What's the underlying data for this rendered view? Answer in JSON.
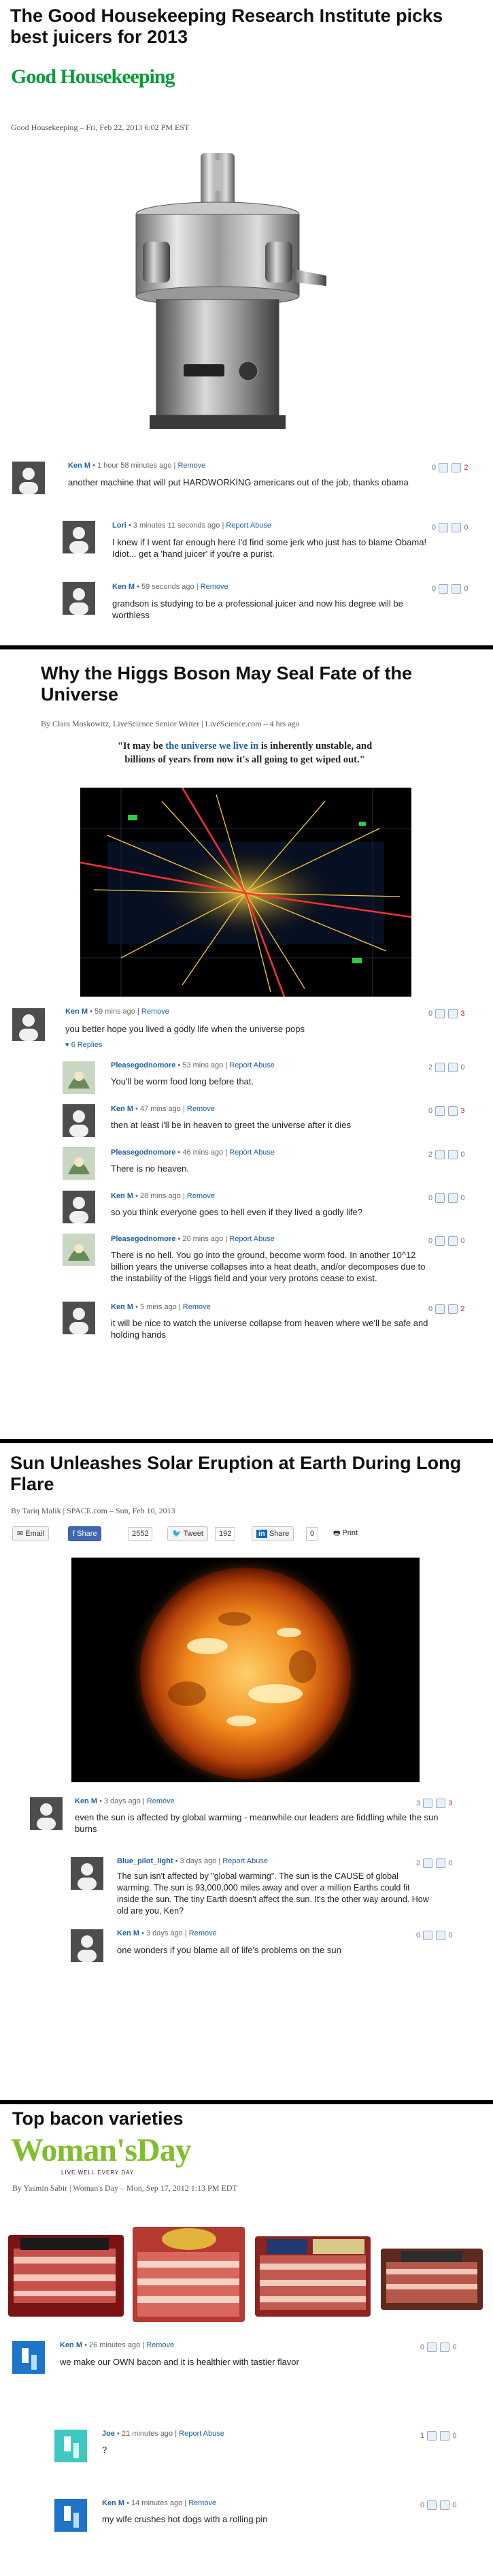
{
  "articles": [
    {
      "title_line1": "The Good Housekeeping Research Institute picks",
      "title_line2": "best juicers for 2013",
      "publication_logo": "Good Housekeeping",
      "byline": "Good Housekeeping – Fri, Feb 22, 2013 6:02 PM EST",
      "image_subject": "stainless-steel-juicer",
      "comments": [
        {
          "name": "Ken M",
          "time": "1 hour 58 minutes ago",
          "actions": "Remove",
          "up": "0",
          "down": "2",
          "text": "another machine that will put HARDWORKING americans out of the job, thanks obama"
        },
        {
          "name": "Lori",
          "time": "3 minutes 11 seconds ago",
          "actions": "Report Abuse",
          "up": "0",
          "down": "0",
          "text_line1": "I knew if I went far enough here I'd find some jerk who just has to blame Obama!",
          "text_line2": "Idiot... get a 'hand juicer' if you're a purist."
        },
        {
          "name": "Ken M",
          "time": "59 seconds ago",
          "actions": "Remove",
          "up": "0",
          "down": "0",
          "text_line1": "grandson is studying to be a professional juicer and now his degree will be",
          "text_line2": "worthless"
        }
      ]
    },
    {
      "title_line1": "Why the Higgs Boson May Seal Fate of the",
      "title_line2": "Universe",
      "byline": "By Clara Moskowitz, LiveScience Senior Writer | LiveScience.com – 4 hrs ago",
      "quote_pre": "\"It may be ",
      "quote_link": "the universe we live in",
      "quote_post": " is inherently unstable, and",
      "quote_line2": "billions of years from now it's all going to get wiped out.\"",
      "replies": "6 Replies",
      "comments": [
        {
          "name": "Ken M",
          "time": "59 mins ago",
          "actions": "Remove",
          "up": "0",
          "down": "3",
          "text": "you better hope you lived a godly life when the universe pops"
        },
        {
          "name": "Pleasegodnomore",
          "time": "53 mins ago",
          "actions": "Report Abuse",
          "up": "2",
          "down": "0",
          "text": "You'll be worm food long before that."
        },
        {
          "name": "Ken M",
          "time": "47 mins ago",
          "actions": "Remove",
          "up": "0",
          "down": "3",
          "text": "then at least i'll be in heaven to greet the universe after it dies"
        },
        {
          "name": "Pleasegodnomore",
          "time": "46 mins ago",
          "actions": "Report Abuse",
          "up": "2",
          "down": "0",
          "text": "There is no heaven."
        },
        {
          "name": "Ken M",
          "time": "28 mins ago",
          "actions": "Remove",
          "up": "0",
          "down": "0",
          "text": "so you think everyone goes to hell even if they lived a godly life?"
        },
        {
          "name": "Pleasegodnomore",
          "time": "20 mins ago",
          "actions": "Report Abuse",
          "up": "0",
          "down": "0",
          "text_line1": "There is no hell. You go into the ground, become worm food. In another 10^12",
          "text_line2": "billion years the universe collapses into a heat death, and/or decomposes due to",
          "text_line3": "the instability of the Higgs field and your very protons cease to exist."
        },
        {
          "name": "Ken M",
          "time": "5 mins ago",
          "actions": "Remove",
          "up": "0",
          "down": "2",
          "text_line1": "it will be nice to watch the universe collapse from heaven where we'll be safe and",
          "text_line2": "holding hands"
        }
      ]
    },
    {
      "title_line1": "Sun Unleashes Solar Eruption at Earth During Long",
      "title_line2": "Flare",
      "byline": "By Tariq Malik | SPACE.com – Sun, Feb 10, 2013",
      "share": {
        "email": "Email",
        "facebook": "Share",
        "facebook_count": "2552",
        "tweet": "Tweet",
        "tweet_count": "192",
        "linkedin": "Share",
        "linkedin_count": "0",
        "print": "Print"
      },
      "comments": [
        {
          "name": "Ken M",
          "time": "3 days ago",
          "actions": "Remove",
          "up": "3",
          "down": "3",
          "text_line1": "even the sun is affected by global warming - meanwhile our leaders are fiddling while the sun",
          "text_line2": "burns"
        },
        {
          "name": "Blue_pilot_light",
          "time": "3 days ago",
          "actions": "Report Abuse",
          "up": "2",
          "down": "0",
          "text_line1": "The sun isn't affected by \"global warming\". The sun is the CAUSE of global",
          "text_line2": "warming. The sun is 93,000,000 miles away and over a million Earths could fit",
          "text_line3": "inside the sun. The tiny Earth doesn't affect the sun. It's the other way around. How",
          "text_line4": "old are you, Ken?"
        },
        {
          "name": "Ken M",
          "time": "3 days ago",
          "actions": "Remove",
          "up": "0",
          "down": "0",
          "text": "one wonders if you blame all of life's problems on the sun"
        }
      ]
    },
    {
      "title": "Top bacon varieties",
      "publication_logo": "Woman'sDay",
      "publication_tagline": "LIVE WELL EVERY DAY",
      "byline": "By Yasmin Sabir | Woman's Day – Mon, Sep 17, 2012 1:13 PM EDT",
      "comments": [
        {
          "name": "Ken M",
          "time": "26 minutes ago",
          "actions": "Remove",
          "up": "0",
          "down": "0",
          "text": "we make our OWN bacon and it is healthier with tastier flavor"
        },
        {
          "name": "Joe",
          "time": "21 minutes ago",
          "actions": "Report Abuse",
          "up": "1",
          "down": "0",
          "text": "?"
        },
        {
          "name": "Ken M",
          "time": "14 minutes ago",
          "actions": "Remove",
          "up": "0",
          "down": "0",
          "text": "my wife crushes hot dogs with a rolling pin"
        }
      ]
    }
  ],
  "colors": {
    "link": "#1d5fa9",
    "negative_vote": "#cc2222",
    "divider": "#000000",
    "gh_green": "#0a9b3a",
    "wd_green": "#7fbf2c"
  }
}
